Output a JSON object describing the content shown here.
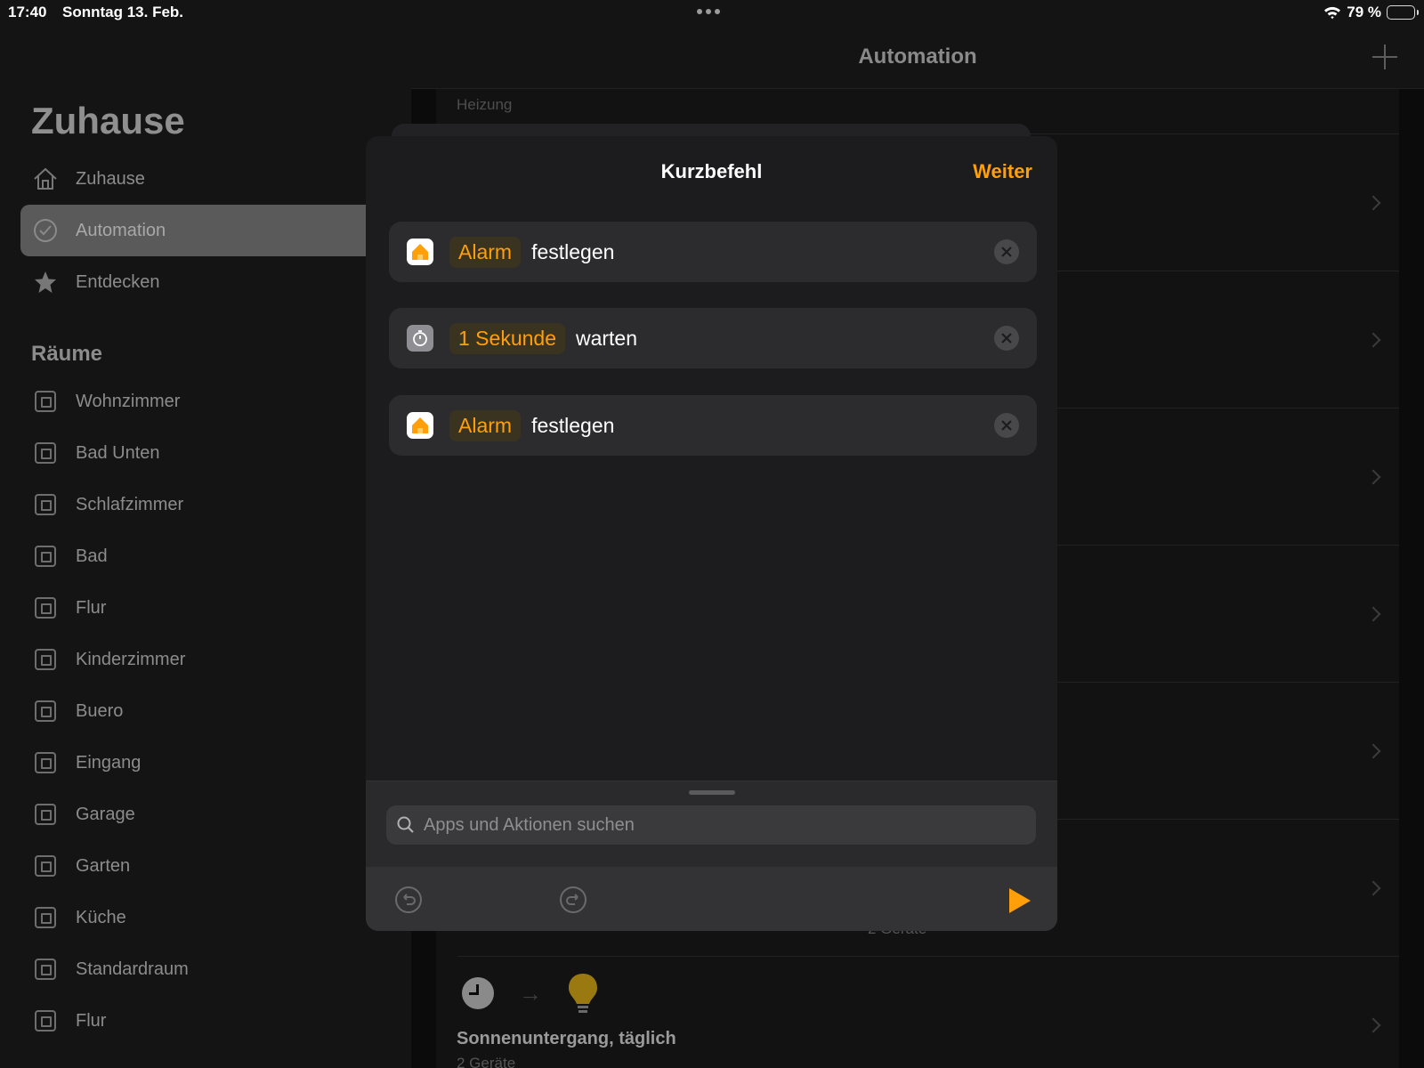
{
  "status": {
    "time": "17:40",
    "date": "Sonntag 13. Feb.",
    "battery": "79 %",
    "battery_level": 0.79
  },
  "sidebar": {
    "title": "Zuhause",
    "nav": [
      {
        "label": "Zuhause",
        "icon": "house-icon"
      },
      {
        "label": "Automation",
        "icon": "clock-icon",
        "selected": true
      },
      {
        "label": "Entdecken",
        "icon": "star-icon"
      }
    ],
    "rooms_title": "Räume",
    "rooms": [
      "Wohnzimmer",
      "Bad Unten",
      "Schlafzimmer",
      "Bad",
      "Flur",
      "Kinderzimmer",
      "Buero",
      "Eingang",
      "Garage",
      "Garten",
      "Küche",
      "Standardraum",
      "Flur"
    ]
  },
  "main": {
    "title": "Automation",
    "section": "Heizung",
    "hidden_sub": "2 Geräte",
    "last_automation": {
      "title": "Sonnenuntergang, täglich",
      "subtitle": "2 Geräte"
    }
  },
  "modal": {
    "title": "Kurzbefehl",
    "next_label": "Weiter",
    "actions": [
      {
        "param": "Alarm",
        "verb": "festlegen",
        "icon": "home-app-icon"
      },
      {
        "param": "1 Sekunde",
        "verb": "warten",
        "icon": "timer-icon"
      },
      {
        "param": "Alarm",
        "verb": "festlegen",
        "icon": "home-app-icon"
      }
    ],
    "search_placeholder": "Apps und Aktionen suchen"
  },
  "colors": {
    "accent": "#ff9f0a",
    "sidebar_bg": "#141414",
    "modal_bg": "#1c1c1e"
  }
}
